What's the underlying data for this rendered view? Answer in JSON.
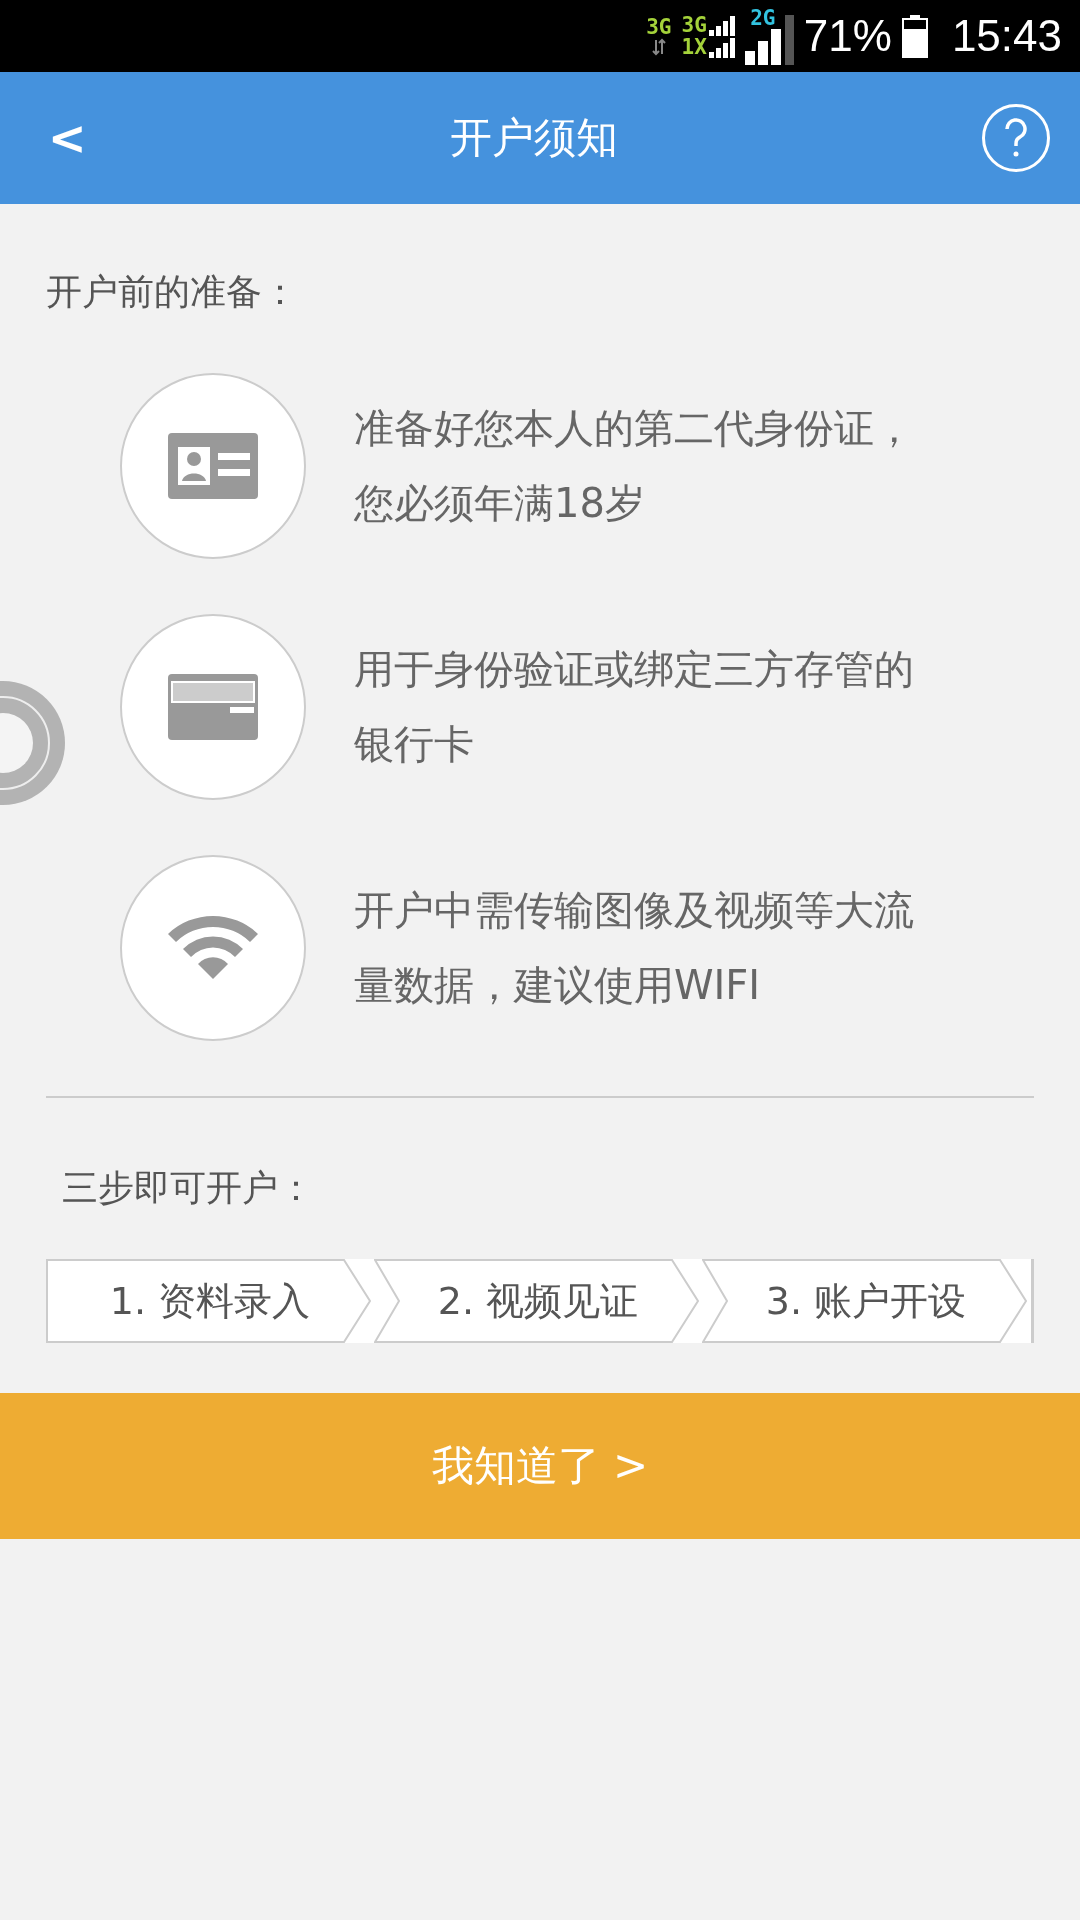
{
  "status_bar": {
    "network_labels": [
      {
        "text": "3G",
        "color": "#a4d23a"
      },
      {
        "text": "3G",
        "color": "#a4d23a"
      },
      {
        "text": "1X",
        "color": "#a4d23a"
      },
      {
        "text": "2G",
        "color": "#33c3e0"
      }
    ],
    "battery": "71%",
    "time": "15:43"
  },
  "header": {
    "back": "<",
    "title": "开户须知"
  },
  "preparation": {
    "heading": "开户前的准备：",
    "items": [
      {
        "kind": "id-card",
        "lines": [
          "准备好您本人的第二代身份证，",
          "您必须年满18岁"
        ]
      },
      {
        "kind": "bank-card",
        "lines": [
          "用于身份验证或绑定三方存管的",
          "银行卡"
        ]
      },
      {
        "kind": "wifi",
        "lines": [
          "开户中需传输图像及视频等大流",
          "量数据，建议使用WIFI"
        ]
      }
    ]
  },
  "steps": {
    "heading": "三步即可开户：",
    "items": [
      "1. 资料录入",
      "2. 视频见证",
      "3. 账户开设"
    ]
  },
  "confirm_button": "我知道了 >"
}
